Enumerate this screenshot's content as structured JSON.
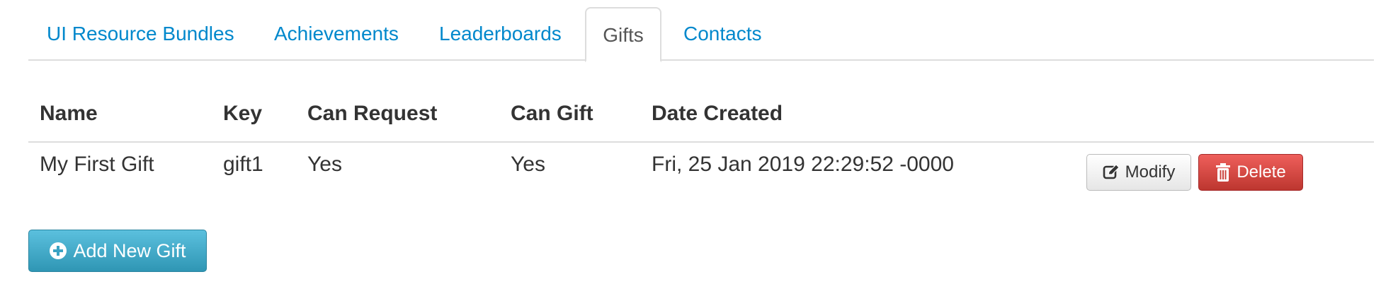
{
  "tabs": [
    {
      "label": "UI Resource Bundles"
    },
    {
      "label": "Achievements"
    },
    {
      "label": "Leaderboards"
    },
    {
      "label": "Gifts",
      "active": true
    },
    {
      "label": "Contacts"
    }
  ],
  "table": {
    "columns": [
      "Name",
      "Key",
      "Can Request",
      "Can Gift",
      "Date Created"
    ],
    "rows": [
      [
        "My First Gift",
        "gift1",
        "Yes",
        "Yes",
        "Fri, 25 Jan 2019 22:29:52 -0000"
      ]
    ],
    "row_actions": {
      "modify_label": "Modify",
      "modify_icon": "edit-icon",
      "delete_label": "Delete",
      "delete_icon": "trash-icon"
    }
  },
  "add_button": {
    "label": "Add New Gift",
    "icon": "plus-circle-icon"
  },
  "colors": {
    "link": "#0088cc",
    "danger": "#da4f49",
    "info": "#49afcd"
  }
}
